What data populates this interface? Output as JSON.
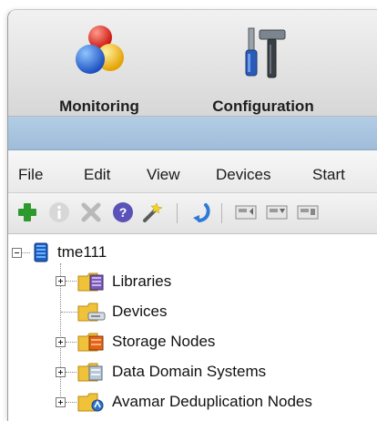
{
  "toolbar": {
    "monitoring_label": "Monitoring",
    "configuration_label": "Configuration"
  },
  "menu": {
    "items": [
      "File",
      "Edit",
      "View",
      "Devices",
      "Start"
    ]
  },
  "icons": {
    "add": "plus-icon",
    "info": "info-icon",
    "delete": "delete-icon",
    "help": "help-icon",
    "wand": "wand-icon",
    "refresh": "refresh-icon"
  },
  "tree": {
    "root": "tme111",
    "children": [
      "Libraries",
      "Devices",
      "Storage Nodes",
      "Data Domain Systems",
      "Avamar Deduplication Nodes"
    ]
  },
  "colors": {
    "accent_band": "#a9c5e0",
    "add_green": "#2e9a2e",
    "folder_yellow": "#f0c23a"
  }
}
